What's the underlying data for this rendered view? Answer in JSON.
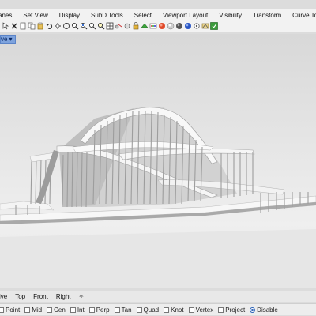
{
  "menubar": {
    "items": [
      "anes",
      "Set View",
      "Display",
      "SubD Tools",
      "Select",
      "Viewport Layout",
      "Visibility",
      "Transform",
      "Curve Tools"
    ]
  },
  "toolbar": {
    "icons": [
      "select-icon",
      "delete-icon",
      "new-icon",
      "copy-icon",
      "paste-icon",
      "undo-icon",
      "pan-icon",
      "rotate-view-icon",
      "zoom-icon",
      "zoom-window-icon",
      "zoom-extents-icon",
      "zoom-selected-icon",
      "viewport-layout-icon",
      "show-icon",
      "hide-icon",
      "lock-icon",
      "properties-icon",
      "layer-icon",
      "render-icon",
      "material-icon",
      "sphere-icon",
      "environment-icon",
      "options-icon",
      "tools-icon",
      "help-icon"
    ]
  },
  "viewport": {
    "title": "ve",
    "dropdown_glyph": "▾"
  },
  "view_tabs": {
    "items": [
      "ive",
      "Top",
      "Front",
      "Right"
    ],
    "add_glyph": "✧"
  },
  "osnap": {
    "items": [
      {
        "label": "Point",
        "checked": false
      },
      {
        "label": "Mid",
        "checked": false
      },
      {
        "label": "Cen",
        "checked": false
      },
      {
        "label": "Int",
        "checked": false
      },
      {
        "label": "Perp",
        "checked": false
      },
      {
        "label": "Tan",
        "checked": false
      },
      {
        "label": "Quad",
        "checked": false
      },
      {
        "label": "Knot",
        "checked": false
      },
      {
        "label": "Vertex",
        "checked": false
      },
      {
        "label": "Project",
        "checked": false
      },
      {
        "label": "Disable",
        "checked": true
      }
    ]
  },
  "colors": {
    "viewport_title_bg": "#7ea3dd",
    "menubar_bg": "#f2f2f2",
    "model_white": "#f7f7f7",
    "model_shadow": "#9a9a9a"
  }
}
